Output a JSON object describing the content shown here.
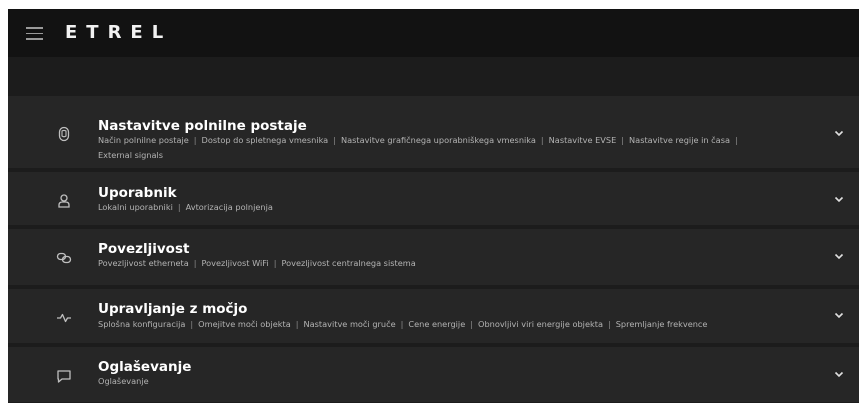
{
  "header": {
    "logo": "ETREL",
    "menu_icon": "hamburger-menu-icon"
  },
  "colors": {
    "topbar": "#121212",
    "background": "#1c1c1c",
    "card": "#262626",
    "title_text": "#ffffff",
    "sub_text": "#b3b3b3"
  },
  "sections": [
    {
      "title": "Nastavitve polnilne postaje",
      "icon": "charging-station-icon",
      "items": [
        "Način polnilne postaje",
        "Dostop do spletnega vmesnika",
        "Nastavitve grafičnega uporabniškega vmesnika",
        "Nastavitve EVSE",
        "Nastavitve regije in časa",
        "External signals"
      ]
    },
    {
      "title": "Uporabnik",
      "icon": "user-icon",
      "items": [
        "Lokalni uporabniki",
        "Avtorizacija polnjenja"
      ]
    },
    {
      "title": "Povezljivost",
      "icon": "link-icon",
      "items": [
        "Povezljivost etherneta",
        "Povezljivost WiFi",
        "Povezljivost centralnega sistema"
      ]
    },
    {
      "title": "Upravljanje z močjo",
      "icon": "power-wave-icon",
      "items": [
        "Splošna konfiguracija",
        "Omejitve moči objekta",
        "Nastavitve moči gruče",
        "Cene energije",
        "Obnovljivi viri energije objekta",
        "Spremljanje frekvence"
      ]
    },
    {
      "title": "Oglaševanje",
      "icon": "message-icon",
      "items": [
        "Oglaševanje"
      ]
    }
  ],
  "separator": "|",
  "expand_icon": "chevron-down-icon"
}
